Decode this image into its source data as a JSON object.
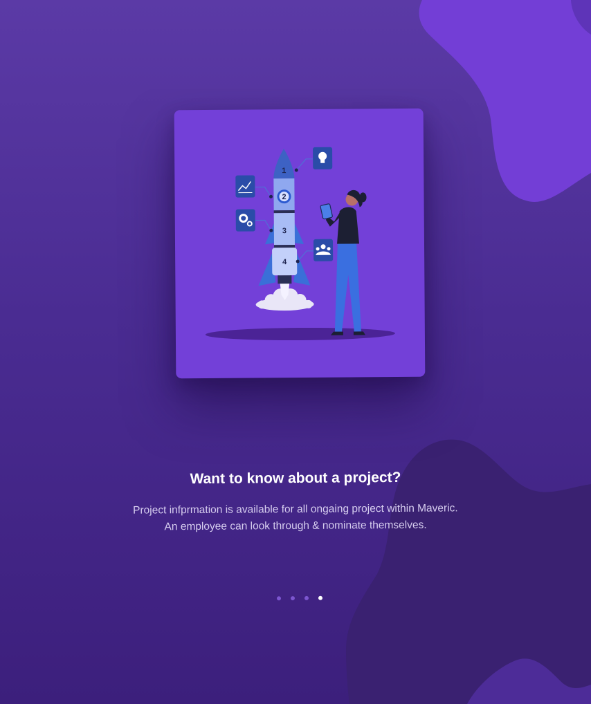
{
  "onboarding": {
    "title": "Want to know about a project?",
    "description_line1": "Project infprmation is available for all ongaing project within Maveric.",
    "description_line2": "An employee can look through & nominate themselves."
  },
  "illustration": {
    "stage_labels": [
      "1",
      "2",
      "3",
      "4"
    ],
    "icons": [
      "lightbulb-icon",
      "chart-icon",
      "gear-icon",
      "team-icon"
    ]
  },
  "pagination": {
    "total": 4,
    "active_index": 3
  },
  "colors": {
    "background": "#4a2c92",
    "card": "#7340d8",
    "accent_blob": "#733ed6",
    "dark_blob": "#3a2171",
    "dot_inactive": "#7c56cf",
    "dot_active": "#ffffff"
  }
}
